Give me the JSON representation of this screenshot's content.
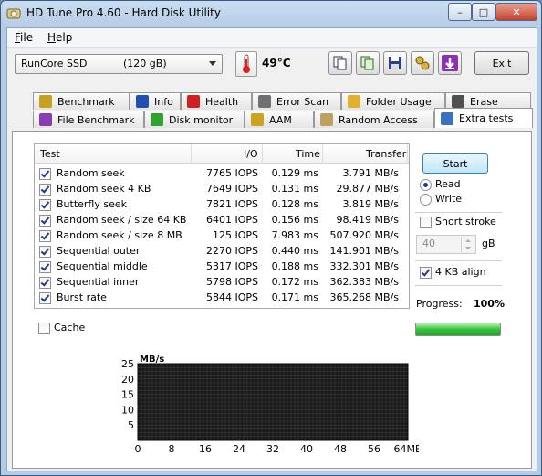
{
  "window": {
    "title": "HD Tune Pro 4.60 - Hard Disk Utility",
    "caption": {
      "minimize": "–",
      "maximize": "□",
      "close": "✕"
    }
  },
  "menu": {
    "file": "File",
    "help": "Help",
    "file_mnemonic": "F",
    "file_rest": "ile",
    "help_mnemonic": "H",
    "help_rest": "elp"
  },
  "toolbar": {
    "drive_name": "RunCore SSD",
    "drive_size": "(120 gB)",
    "temperature": "49°C",
    "exit_label": "Exit"
  },
  "tabs_row1": [
    {
      "label": "Benchmark",
      "icon": "benchmark-icon"
    },
    {
      "label": "Info",
      "icon": "info-icon"
    },
    {
      "label": "Health",
      "icon": "health-icon"
    },
    {
      "label": "Error Scan",
      "icon": "error-scan-icon"
    },
    {
      "label": "Folder Usage",
      "icon": "folder-icon"
    },
    {
      "label": "Erase",
      "icon": "erase-icon"
    }
  ],
  "tabs_row2": [
    {
      "label": "File Benchmark",
      "icon": "file-benchmark-icon"
    },
    {
      "label": "Disk monitor",
      "icon": "disk-monitor-icon"
    },
    {
      "label": "AAM",
      "icon": "speaker-icon"
    },
    {
      "label": "Random Access",
      "icon": "random-access-icon"
    },
    {
      "label": "Extra tests",
      "icon": "extra-tests-icon",
      "active": true
    }
  ],
  "table": {
    "headers": {
      "test": "Test",
      "io": "I/O",
      "time": "Time",
      "transfer": "Transfer"
    },
    "rows": [
      {
        "test": "Random seek",
        "io": "7765 IOPS",
        "time": "0.129 ms",
        "transfer": "3.791 MB/s",
        "checked": true
      },
      {
        "test": "Random seek 4 KB",
        "io": "7649 IOPS",
        "time": "0.131 ms",
        "transfer": "29.877 MB/s",
        "checked": true
      },
      {
        "test": "Butterfly seek",
        "io": "7821 IOPS",
        "time": "0.128 ms",
        "transfer": "3.819 MB/s",
        "checked": true
      },
      {
        "test": "Random seek / size 64 KB",
        "io": "6401 IOPS",
        "time": "0.156 ms",
        "transfer": "98.419 MB/s",
        "checked": true
      },
      {
        "test": "Random seek / size 8 MB",
        "io": "125 IOPS",
        "time": "7.983 ms",
        "transfer": "507.920 MB/s",
        "checked": true
      },
      {
        "test": "Sequential outer",
        "io": "2270 IOPS",
        "time": "0.440 ms",
        "transfer": "141.901 MB/s",
        "checked": true
      },
      {
        "test": "Sequential middle",
        "io": "5317 IOPS",
        "time": "0.188 ms",
        "transfer": "332.301 MB/s",
        "checked": true
      },
      {
        "test": "Sequential inner",
        "io": "5798 IOPS",
        "time": "0.172 ms",
        "transfer": "362.383 MB/s",
        "checked": true
      },
      {
        "test": "Burst rate",
        "io": "5844 IOPS",
        "time": "0.171 ms",
        "transfer": "365.268 MB/s",
        "checked": true
      }
    ]
  },
  "options": {
    "start_label": "Start",
    "read_label": "Read",
    "write_label": "Write",
    "mode_selected": "Read",
    "short_stroke_label": "Short stroke",
    "short_stroke_checked": false,
    "short_stroke_value": "40",
    "short_stroke_unit": "gB",
    "align_label": "4 KB align",
    "align_checked": true,
    "progress_label": "Progress:",
    "progress_value": "100%",
    "progress_fraction": 1.0,
    "cache_label": "Cache",
    "cache_checked": false
  },
  "chart_data": {
    "type": "line",
    "ylabel": "MB/s",
    "xlabel": "",
    "ylim": [
      0,
      25
    ],
    "xlim": [
      0,
      64
    ],
    "yticks": [
      "25",
      "20",
      "15",
      "10",
      "5"
    ],
    "xticks": [
      "0",
      "8",
      "16",
      "24",
      "32",
      "40",
      "48",
      "56",
      "64MB"
    ],
    "series": [],
    "grid": true,
    "background": "#1a1a1a"
  }
}
